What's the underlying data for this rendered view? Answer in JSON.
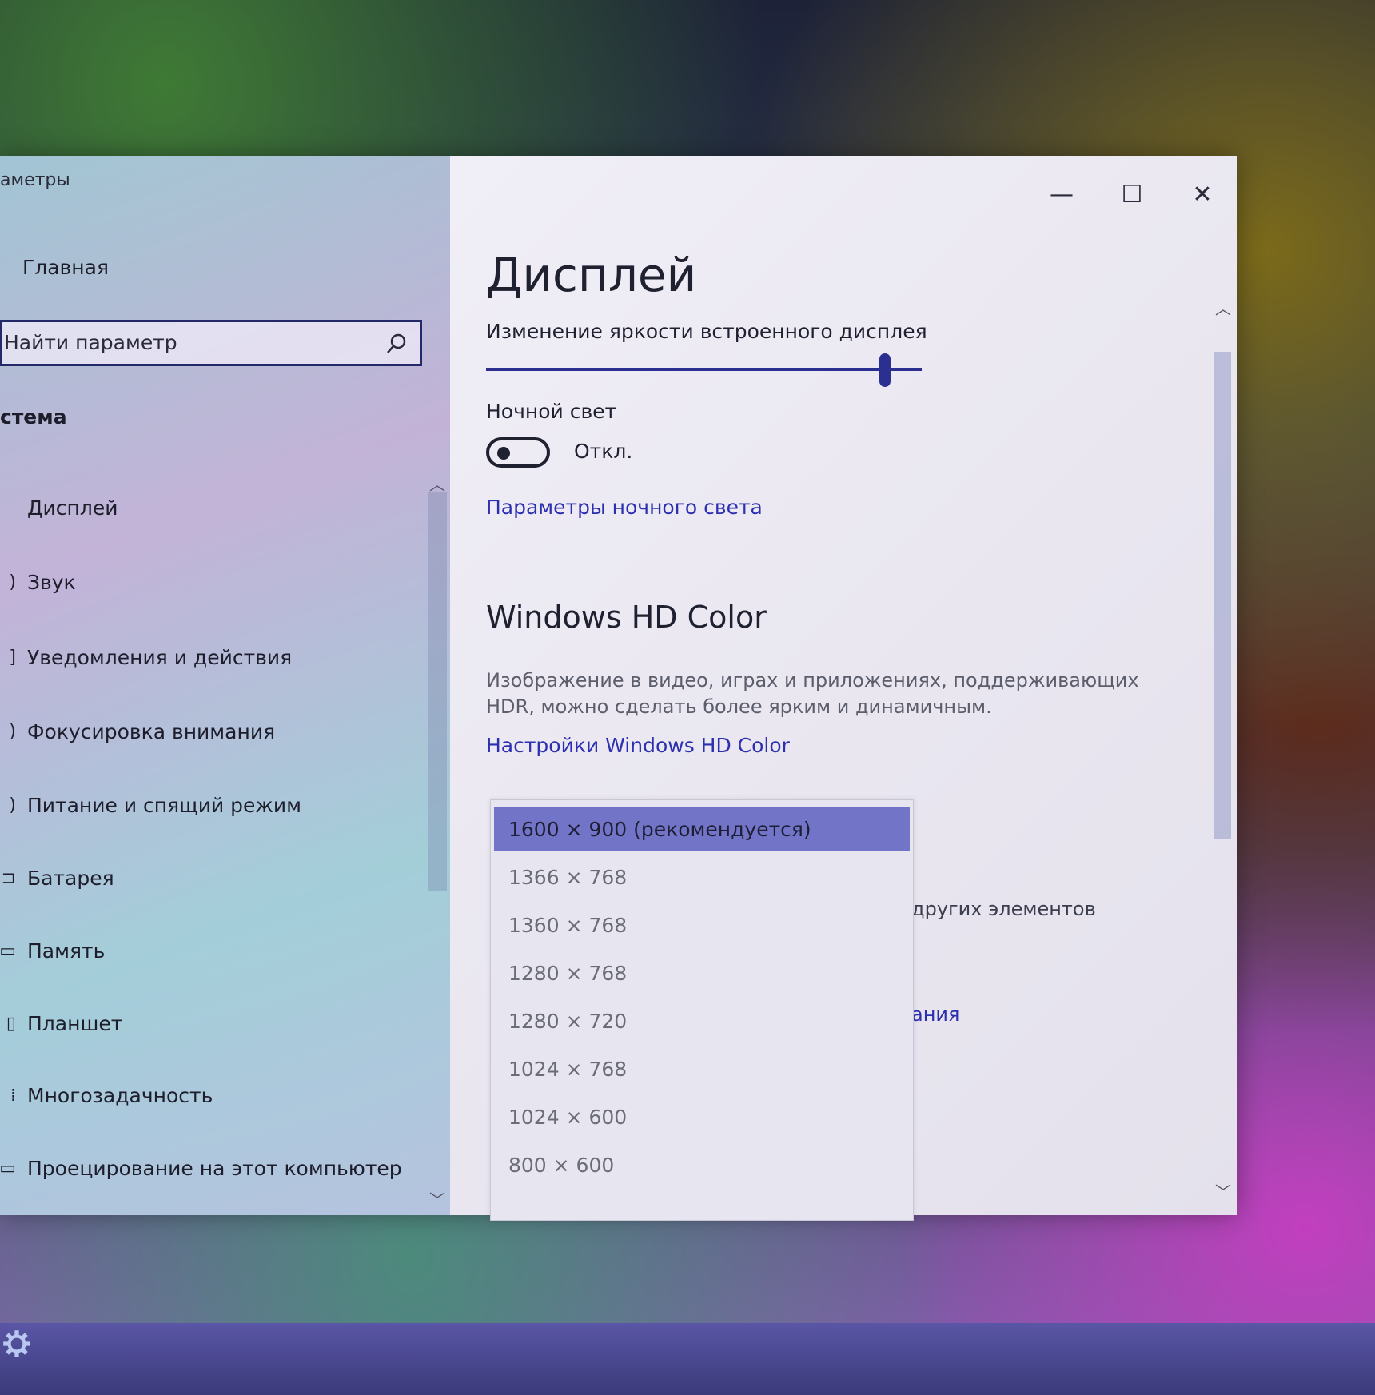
{
  "window": {
    "app_title": "аметры",
    "controls": {
      "minimize": "—",
      "maximize": "☐",
      "close": "✕"
    }
  },
  "sidebar": {
    "home_label": "Главная",
    "search": {
      "placeholder": "Найти параметр"
    },
    "section_title": "стема",
    "items": [
      {
        "label": "Дисплей",
        "icon": "display-icon"
      },
      {
        "label": "Звук",
        "icon": "sound-icon"
      },
      {
        "label": "Уведомления и действия",
        "icon": "notifications-icon"
      },
      {
        "label": "Фокусировка внимания",
        "icon": "focus-icon"
      },
      {
        "label": "Питание и спящий режим",
        "icon": "power-icon"
      },
      {
        "label": "Батарея",
        "icon": "battery-icon"
      },
      {
        "label": "Память",
        "icon": "storage-icon"
      },
      {
        "label": "Планшет",
        "icon": "tablet-icon"
      },
      {
        "label": "Многозадачность",
        "icon": "multitasking-icon"
      },
      {
        "label": "Проецирование на этот компьютер",
        "icon": "projecting-icon"
      }
    ]
  },
  "main": {
    "page_title": "Дисплей",
    "brightness_label": "Изменение яркости встроенного дисплея",
    "brightness_value": 1.0,
    "night_light": {
      "label": "Ночной свет",
      "state_label": "Откл.",
      "settings_link": "Параметры ночного света"
    },
    "hd_color": {
      "title": "Windows HD Color",
      "description": "Изображение в видео, играх и приложениях, поддерживающих HDR, можно сделать более ярким и динамичным.",
      "settings_link": "Настройки Windows HD Color"
    },
    "partially_hidden": {
      "text_1": "других элементов",
      "text_2": "ания"
    },
    "resolution_dropdown": {
      "selected_index": 0,
      "options": [
        "1600 × 900 (рекомендуется)",
        "1366 × 768",
        "1360 × 768",
        "1280 × 768",
        "1280 × 720",
        "1024 × 768",
        "1024 × 600",
        "800 × 600"
      ]
    }
  },
  "colors": {
    "accent": "#2b2f8f",
    "link": "#2c2fb0",
    "selected_option": "#7274c8"
  }
}
